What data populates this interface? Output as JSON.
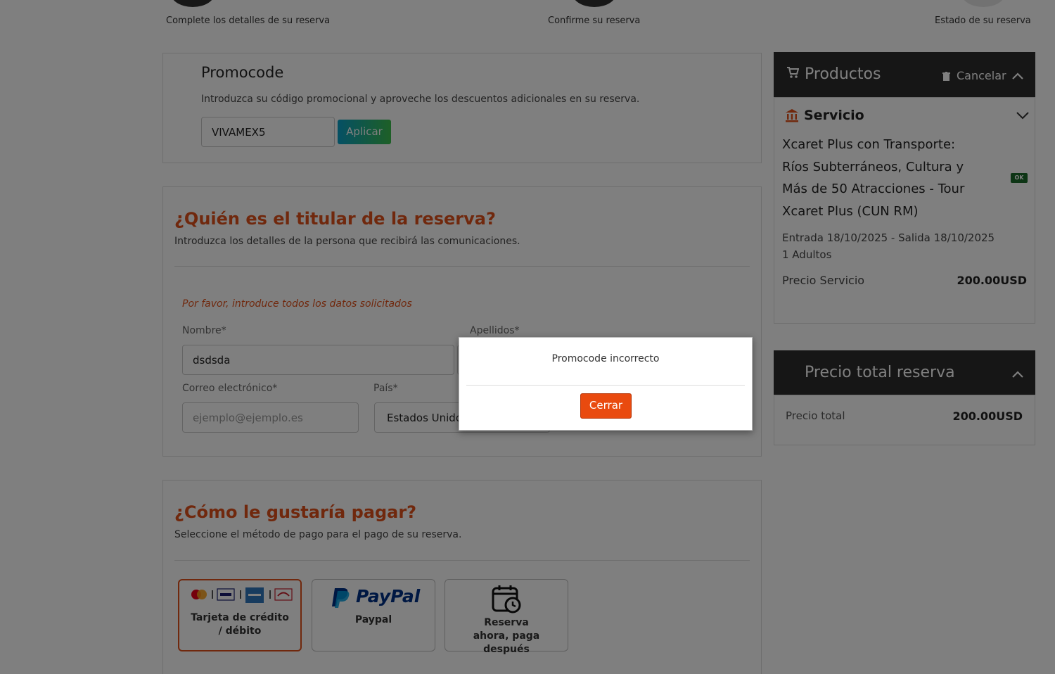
{
  "steps": [
    {
      "label": "Complete los detalles de su reserva"
    },
    {
      "label": "Confirme su reserva"
    },
    {
      "label": "Estado de su reserva"
    }
  ],
  "promo": {
    "title": "Promocode",
    "description": "Introduzca su código promocional y aproveche los descuentos adicionales en su reserva.",
    "input_value": "VIVAMEX5",
    "apply_label": "Aplicar"
  },
  "holder": {
    "title": "¿Quién es el titular de la reserva?",
    "subtitle": "Introduzca los detalles de la persona que recibirá las comunicaciones.",
    "warning": "Por favor, introduce todos los datos solicitados",
    "first_name_label": "Nombre*",
    "first_name_value": "dsdsda",
    "last_name_label": "Apellidos*",
    "email_label": "Correo electrónico*",
    "email_placeholder": "ejemplo@ejemplo.es",
    "country_label": "País*",
    "country_value": "Estados Unidos"
  },
  "payment": {
    "title": "¿Cómo le gustaría pagar?",
    "subtitle": "Seleccione el método de pago para el pago de su reserva.",
    "options": [
      {
        "label": "Tarjeta de crédito / débito",
        "selected": true
      },
      {
        "label": "Paypal",
        "logo_text": "PayPal",
        "selected": false
      },
      {
        "label": "Reserva ahora, paga después",
        "selected": false
      }
    ]
  },
  "products": {
    "header_title": "Productos",
    "cancel_label": "Cancelar",
    "service_title": "Servicio",
    "product_name": "Xcaret Plus con Transporte: Ríos Subterráneos, Cultura y Más de 50 Atracciones - Tour Xcaret Plus (CUN RM)",
    "status_badge": "OK",
    "dates": "Entrada 18/10/2025 - Salida 18/10/2025",
    "pax": "1 Adultos",
    "price_label": "Precio Servicio",
    "price_value": "200.00USD"
  },
  "total": {
    "header_title": "Precio total reserva",
    "label": "Precio total",
    "value": "200.00USD"
  },
  "modal": {
    "message": "Promocode incorrecto",
    "close_label": "Cerrar"
  },
  "colors": {
    "accent_orange": "#e0501a",
    "sidebar_header": "#2d2d2d",
    "overlay": "rgba(0,0,0,0.5)",
    "badge_green": "#1b6b2a"
  }
}
